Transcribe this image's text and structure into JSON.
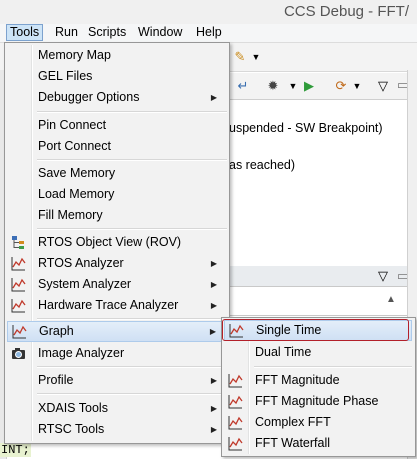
{
  "window": {
    "title": "CCS Debug - FFT/"
  },
  "menubar": {
    "items": [
      {
        "label": "Tools"
      },
      {
        "label": "Run"
      },
      {
        "label": "Scripts"
      },
      {
        "label": "Window"
      },
      {
        "label": "Help"
      }
    ]
  },
  "background": {
    "status_line1": "uspended - SW Breakpoint)",
    "status_line2": "as reached)",
    "code_fragment": "INT;"
  },
  "tools_menu": {
    "items": [
      {
        "label": "Memory Map"
      },
      {
        "label": "GEL Files"
      },
      {
        "label": "Debugger Options"
      },
      {
        "label": "Pin Connect"
      },
      {
        "label": "Port Connect"
      },
      {
        "label": "Save Memory"
      },
      {
        "label": "Load Memory"
      },
      {
        "label": "Fill Memory"
      },
      {
        "label": "RTOS Object View (ROV)"
      },
      {
        "label": "RTOS Analyzer"
      },
      {
        "label": "System Analyzer"
      },
      {
        "label": "Hardware Trace Analyzer"
      },
      {
        "label": "Graph"
      },
      {
        "label": "Image Analyzer"
      },
      {
        "label": "Profile"
      },
      {
        "label": "XDAIS Tools"
      },
      {
        "label": "RTSC Tools"
      }
    ]
  },
  "graph_submenu": {
    "items": [
      {
        "label": "Single Time"
      },
      {
        "label": "Dual Time"
      },
      {
        "label": "FFT Magnitude"
      },
      {
        "label": "FFT Magnitude Phase"
      },
      {
        "label": "Complex FFT"
      },
      {
        "label": "FFT Waterfall"
      }
    ]
  },
  "colors": {
    "highlight": "#cfe0f4",
    "annotation": "#b3202a"
  }
}
